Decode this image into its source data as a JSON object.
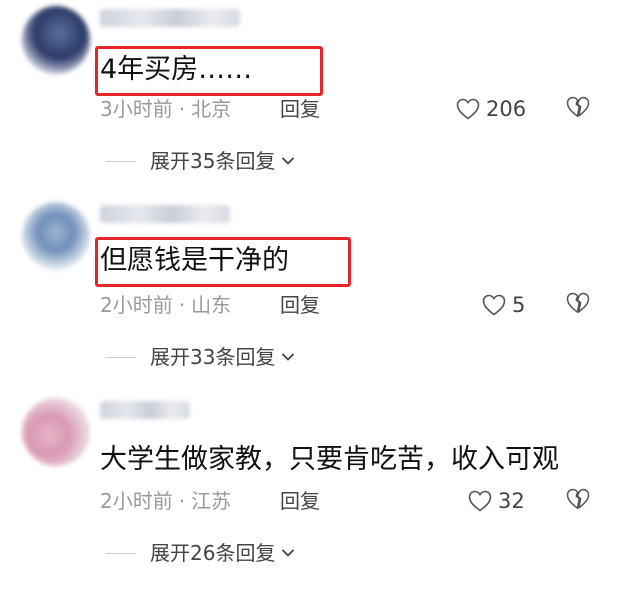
{
  "comments": [
    {
      "text": "4年买房……",
      "time": "3小时前",
      "separator": "·",
      "location": "北京",
      "reply_label": "回复",
      "likes": "206",
      "expand_label": "展开35条回复"
    },
    {
      "text": "但愿钱是干净的",
      "time": "2小时前",
      "separator": "·",
      "location": "山东",
      "reply_label": "回复",
      "likes": "5",
      "expand_label": "展开33条回复"
    },
    {
      "text": "大学生做家教，只要肯吃苦，收入可观",
      "time": "2小时前",
      "separator": "·",
      "location": "江苏",
      "reply_label": "回复",
      "likes": "32",
      "expand_label": "展开26条回复"
    }
  ],
  "icons": {
    "like": "heart-outline-icon",
    "dislike": "broken-heart-icon",
    "expand": "chevron-down-icon"
  },
  "colors": {
    "highlight_box": "#e5262a",
    "meta_text": "#9a9a9a",
    "body_text": "#111111"
  }
}
